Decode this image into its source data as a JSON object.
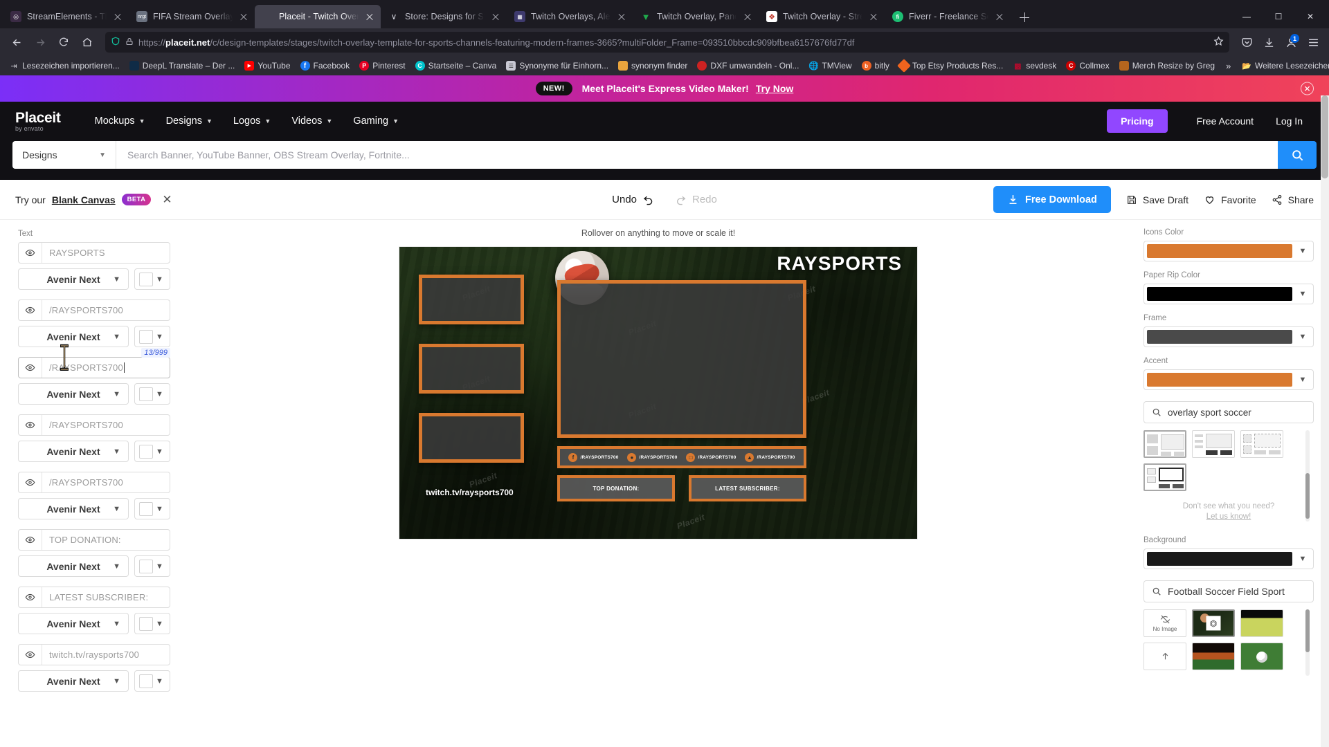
{
  "browser": {
    "tabs": [
      {
        "title": "StreamElements - Themes ga",
        "favicon": "streamelements-icon",
        "color": "#3b2b45",
        "glyph": "◔",
        "active": false
      },
      {
        "title": "FIFA Stream Overlay for free,",
        "favicon": "nrgt-icon",
        "color": "#555a66",
        "glyph": "▦",
        "active": false
      },
      {
        "title": "Placeit - Twitch Overlay Temp",
        "favicon": "placeit-icon",
        "color": "#42414d",
        "glyph": "",
        "active": true
      },
      {
        "title": "Store: Designs for Streamers a",
        "favicon": "store-icon",
        "color": "#2b2a33",
        "glyph": "∨",
        "active": false
      },
      {
        "title": "Twitch Overlays, Alerts and G",
        "favicon": "grid-icon",
        "color": "#4a4a7a",
        "glyph": "▒",
        "active": false
      },
      {
        "title": "Twitch Overlay, Panels and Yo",
        "favicon": "green-icon",
        "color": "#1faa4b",
        "glyph": "▼",
        "active": false
      },
      {
        "title": "Twitch Overlay - Stream Overl",
        "favicon": "red-card-icon",
        "color": "#c0392b",
        "glyph": "❖",
        "active": false
      },
      {
        "title": "Fiverr - Freelance Services Ma",
        "favicon": "fiverr-icon",
        "color": "#1dbf73",
        "glyph": "fi",
        "active": false
      }
    ],
    "new_tab_label": "+",
    "window_controls": {
      "minimize": "—",
      "maximize": "☐",
      "close": "✕"
    },
    "nav": {
      "back": "back-arrow",
      "forward": "forward-arrow",
      "reload": "reload-icon",
      "home": "home-icon"
    },
    "url_prefix": "https://",
    "url_domain": "placeit.net",
    "url_path": "/c/design-templates/stages/twitch-overlay-template-for-sports-channels-featuring-modern-frames-3665?multiFolder_Frame=093510bbcdc909bfbea6157676fd77df",
    "toolbar_badge": "1",
    "bookmarks": [
      {
        "label": "Lesezeichen importieren...",
        "icon": "import-icon",
        "color": "#2b2a33"
      },
      {
        "label": "DeepL Translate – Der ...",
        "icon": "deepl-icon",
        "color": "#0f2b46"
      },
      {
        "label": "YouTube",
        "icon": "youtube-icon",
        "color": "#ff0000"
      },
      {
        "label": "Facebook",
        "icon": "facebook-icon",
        "color": "#1877f2"
      },
      {
        "label": "Pinterest",
        "icon": "pinterest-icon",
        "color": "#e60023"
      },
      {
        "label": "Startseite – Canva",
        "icon": "canva-icon",
        "color": "#00c4cc"
      },
      {
        "label": "Synonyme für Einhorn...",
        "icon": "synonyme-icon",
        "color": "#c9c9d4"
      },
      {
        "label": "synonym finder",
        "icon": "book-icon",
        "color": "#e8a33d"
      },
      {
        "label": "DXF umwandeln - Onl...",
        "icon": "dxf-icon",
        "color": "#cc2222"
      },
      {
        "label": "TMView",
        "icon": "globe-icon",
        "color": "#555e6b"
      },
      {
        "label": "bitly",
        "icon": "bitly-icon",
        "color": "#ee6123"
      },
      {
        "label": "Top Etsy Products Res...",
        "icon": "etsy-icon",
        "color": "#f1641e"
      },
      {
        "label": "sevdesk",
        "icon": "chart-icon",
        "color": "#e4002b"
      },
      {
        "label": "Collmex",
        "icon": "collmex-icon",
        "color": "#cc0000"
      },
      {
        "label": "Merch Resize by Greg",
        "icon": "merch-icon",
        "color": "#b5651d"
      }
    ],
    "bookmarks_overflow": "»",
    "bookmarks_more_label": "Weitere Lesezeichen"
  },
  "promo": {
    "badge": "NEW!",
    "text": "Meet Placeit's Express Video Maker!",
    "cta": "Try Now",
    "close": "✕"
  },
  "header": {
    "logo_line1": "Placeit",
    "logo_line2": "by envato",
    "nav": [
      {
        "label": "Mockups"
      },
      {
        "label": "Designs"
      },
      {
        "label": "Logos"
      },
      {
        "label": "Videos"
      },
      {
        "label": "Gaming"
      }
    ],
    "pricing": "Pricing",
    "free_account": "Free Account",
    "log_in": "Log In"
  },
  "search": {
    "category": "Designs",
    "placeholder": "Search Banner, YouTube Banner, OBS Stream Overlay, Fortnite...",
    "go_icon": "search-icon"
  },
  "editor_toolbar": {
    "try_our": "Try our",
    "blank_canvas": "Blank Canvas",
    "beta": "BETA",
    "close": "✕",
    "undo": "Undo",
    "redo": "Redo",
    "free_download": "Free Download",
    "save_draft": "Save Draft",
    "favorite": "Favorite",
    "share": "Share"
  },
  "left_panel": {
    "section_label": "Text",
    "char_count": "13/999",
    "fields": [
      {
        "value": "RAYSPORTS",
        "font": "Avenir Next",
        "focused": false
      },
      {
        "value": "/RAYSPORTS700",
        "font": "Avenir Next",
        "focused": false
      },
      {
        "value": "/RAYSPORTS700",
        "font": "Avenir Next",
        "focused": true
      },
      {
        "value": "/RAYSPORTS700",
        "font": "Avenir Next",
        "focused": false
      },
      {
        "value": "/RAYSPORTS700",
        "font": "Avenir Next",
        "focused": false
      },
      {
        "value": "TOP DONATION:",
        "font": "Avenir Next",
        "focused": false
      },
      {
        "value": "LATEST SUBSCRIBER:",
        "font": "Avenir Next",
        "focused": false
      },
      {
        "value": "twitch.tv/raysports700",
        "font": "Avenir Next",
        "focused": false
      }
    ]
  },
  "canvas": {
    "hint": "Rollover on anything to move or scale it!",
    "overlay_title": "RAYSPORTS",
    "watermark": "Placeit",
    "socials": [
      {
        "icon": "facebook-icon",
        "label": "/RAYSPORTS700"
      },
      {
        "icon": "twitter-icon",
        "label": "/RAYSPORTS700"
      },
      {
        "icon": "instagram-icon",
        "label": "/RAYSPORTS700"
      },
      {
        "icon": "twitch-icon",
        "label": "/RAYSPORTS700"
      }
    ],
    "top_donation": "TOP DONATION:",
    "latest_subscriber": "LATEST SUBSCRIBER:",
    "twitch_url": "twitch.tv/raysports700"
  },
  "right_panel": {
    "icons_color_label": "Icons Color",
    "icons_color": "#d9792f",
    "paper_rip_label": "Paper Rip Color",
    "paper_rip_color": "#000000",
    "frame_label": "Frame",
    "frame_color": "#4a4a4a",
    "accent_label": "Accent",
    "accent_color": "#d9792f",
    "frame_search": "overlay sport soccer",
    "frame_search_icon": "search-icon",
    "dont_see": "Don't see what you need?",
    "let_us_know": "Let us know!",
    "background_label": "Background",
    "background_color": "#1a1a1a",
    "background_search": "Football Soccer Field Sport",
    "no_image_label": "No Image",
    "upload_label": "upload-icon"
  }
}
